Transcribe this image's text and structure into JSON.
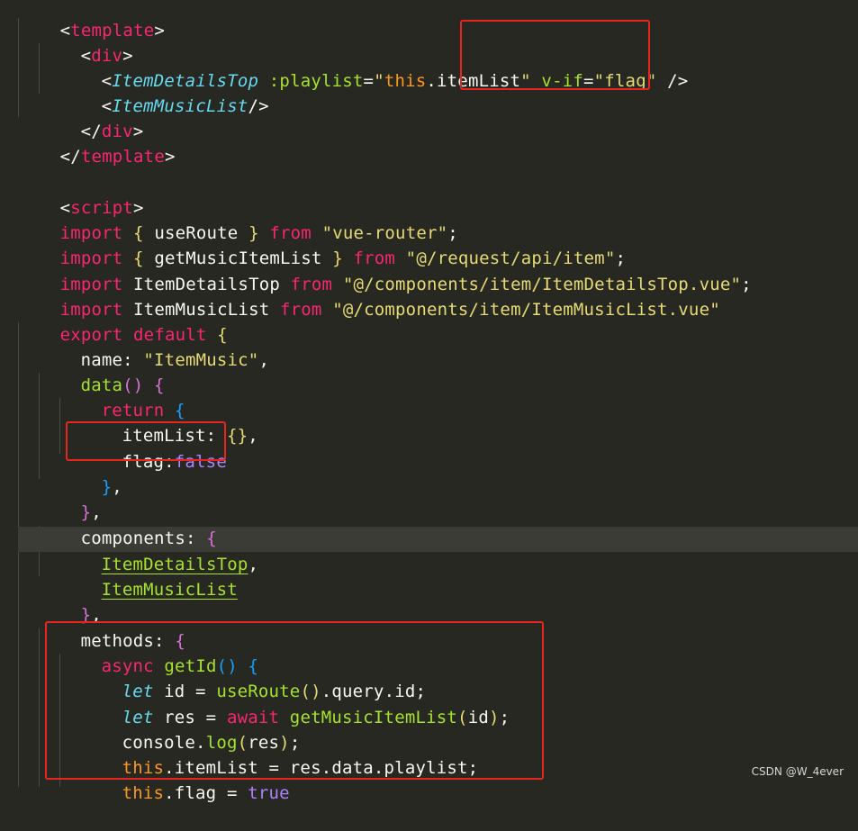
{
  "code": {
    "line1": {
      "open": "<",
      "tag": "template",
      "close": ">"
    },
    "line2": {
      "open": "<",
      "tag": "div",
      "close": ">"
    },
    "line3": {
      "open": "<",
      "comp": "ItemDetailsTop",
      "attr1": " :playlist",
      "eq1": "=",
      "q1": "\"",
      "this": "this",
      "rest1": ".itemList",
      "q2": "\"",
      "attr2": " v-if",
      "eq2": "=",
      "val2": "\"flag\"",
      "end": " />"
    },
    "line4": {
      "open": "<",
      "comp": "ItemMusicList",
      "end": "/>"
    },
    "line5": {
      "open": "</",
      "tag": "div",
      "close": ">"
    },
    "line6": {
      "open": "</",
      "tag": "template",
      "close": ">"
    },
    "line8": {
      "open": "<",
      "tag": "script",
      "close": ">"
    },
    "line9": {
      "kw": "import",
      "b1": " { ",
      "name": "useRoute",
      "b2": " } ",
      "from": "from",
      "str": " \"vue-router\"",
      "semi": ";"
    },
    "line10": {
      "kw": "import",
      "b1": " { ",
      "name": "getMusicItemList",
      "b2": " } ",
      "from": "from",
      "str": " \"@/request/api/item\"",
      "semi": ";"
    },
    "line11": {
      "kw": "import",
      "name": " ItemDetailsTop ",
      "from": "from",
      "str": " \"@/components/item/ItemDetailsTop.vue\"",
      "semi": ";"
    },
    "line12": {
      "kw": "import",
      "name": " ItemMusicList ",
      "from": "from",
      "str": " \"@/components/item/ItemMusicList.vue\""
    },
    "line13": {
      "kw": "export default",
      "brace": " {"
    },
    "line14": {
      "key": "name: ",
      "str": "\"ItemMusic\"",
      "comma": ","
    },
    "line15": {
      "fn": "data",
      "paren": "()",
      "brace": " {"
    },
    "line16": {
      "kw": "return",
      "brace": " {"
    },
    "line17": {
      "key": "itemList: ",
      "val": "{}",
      "comma": ","
    },
    "line18": {
      "key": "flag:",
      "val": "false"
    },
    "line19": {
      "brace": "}",
      "comma": ","
    },
    "line20": {
      "brace": "}",
      "comma": ","
    },
    "line21": {
      "key": "components: ",
      "brace": "{"
    },
    "line22": {
      "name": "ItemDetailsTop",
      "comma": ","
    },
    "line23": {
      "name": "ItemMusicList"
    },
    "line24": {
      "brace": "}",
      "comma": ","
    },
    "line25": {
      "key": "methods: ",
      "brace": "{"
    },
    "line26": {
      "kw": "async",
      "fn": " getId",
      "paren": "()",
      "brace": " {"
    },
    "line27": {
      "let": "let",
      "v": " id = ",
      "fn": "useRoute",
      "paren": "()",
      "rest": ".query.id;"
    },
    "line28": {
      "let": "let",
      "v": " res = ",
      "kw": "await",
      "fn": " getMusicItemList",
      "p1": "(",
      "arg": "id",
      "p2": ")",
      "semi": ";"
    },
    "line29": {
      "obj": "console.",
      "fn": "log",
      "p1": "(",
      "arg": "res",
      "p2": ")",
      "semi": ";"
    },
    "line30": {
      "this": "this",
      "rest": ".itemList = res.data.playlist;"
    },
    "line31": {
      "this": "this",
      "rest": ".flag = ",
      "val": "true"
    }
  },
  "watermark": "CSDN @W_4ever",
  "colors": {
    "background": "#272822",
    "annotation_box": "#e8261f"
  }
}
